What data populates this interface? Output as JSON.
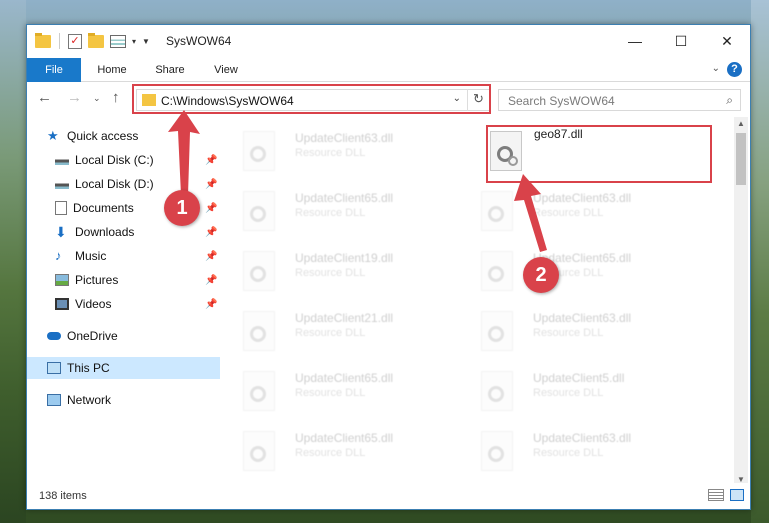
{
  "window": {
    "title": "SysWOW64",
    "controls": {
      "minimize": "—",
      "maximize": "☐",
      "close": "✕"
    }
  },
  "ribbon": {
    "tabs": [
      "File",
      "Home",
      "Share",
      "View"
    ],
    "help": "?"
  },
  "navbar": {
    "address": "C:\\Windows\\SysWOW64",
    "search_placeholder": "Search SysWOW64"
  },
  "sidebar": {
    "items": [
      {
        "label": "Quick access",
        "icon": "star-icon",
        "pinned": false
      },
      {
        "label": "Local Disk (C:)",
        "icon": "drive-icon",
        "pinned": true
      },
      {
        "label": "Local Disk (D:)",
        "icon": "drive-icon",
        "pinned": true
      },
      {
        "label": "Documents",
        "icon": "document-icon",
        "pinned": true
      },
      {
        "label": "Downloads",
        "icon": "download-icon",
        "pinned": true
      },
      {
        "label": "Music",
        "icon": "music-icon",
        "pinned": true
      },
      {
        "label": "Pictures",
        "icon": "pictures-icon",
        "pinned": true
      },
      {
        "label": "Videos",
        "icon": "video-icon",
        "pinned": true
      },
      {
        "label": "OneDrive",
        "icon": "cloud-icon",
        "pinned": false
      },
      {
        "label": "This PC",
        "icon": "computer-icon",
        "pinned": false,
        "selected": true
      },
      {
        "label": "Network",
        "icon": "network-icon",
        "pinned": false
      }
    ]
  },
  "files": {
    "highlighted": {
      "name": "geo87.dll"
    },
    "left_column": [
      {
        "name": "UpdateClient63.dll",
        "type": "Resource DLL"
      },
      {
        "name": "UpdateClient65.dll",
        "type": "Resource DLL"
      },
      {
        "name": "UpdateClient19.dll",
        "type": "Resource DLL"
      },
      {
        "name": "UpdateClient21.dll",
        "type": "Resource DLL"
      },
      {
        "name": "UpdateClient65.dll",
        "type": "Resource DLL"
      },
      {
        "name": "UpdateClient65.dll",
        "type": "Resource DLL"
      }
    ],
    "right_column": [
      {
        "name": "UpdateClient63.dll",
        "type": "Resource DLL"
      },
      {
        "name": "UpdateClient65.dll",
        "type": "Resource DLL"
      },
      {
        "name": "UpdateClient63.dll",
        "type": "Resource DLL"
      },
      {
        "name": "UpdateClient5.dll",
        "type": "Resource DLL"
      },
      {
        "name": "UpdateClient63.dll",
        "type": "Resource DLL"
      }
    ]
  },
  "status": {
    "item_count": "138 items"
  },
  "annotations": {
    "step1": "1",
    "step2": "2",
    "color": "#d9424a"
  }
}
